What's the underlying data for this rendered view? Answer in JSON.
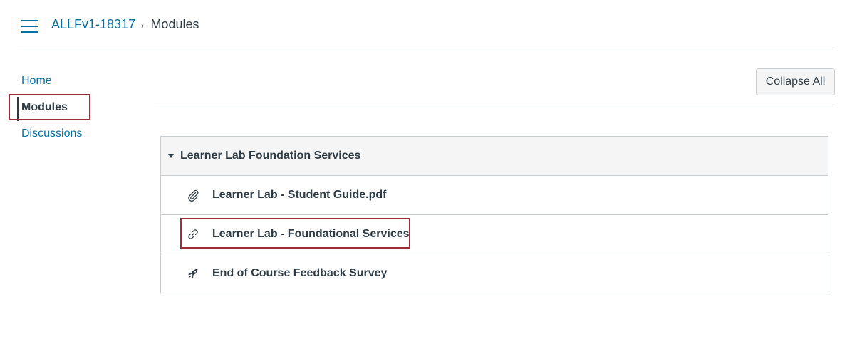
{
  "header": {
    "menu_icon": "hamburger-menu-icon",
    "breadcrumb": {
      "course": "ALLFv1-18317",
      "separator": "›",
      "current": "Modules"
    }
  },
  "course_nav": {
    "items": [
      {
        "label": "Home",
        "active": false
      },
      {
        "label": "Modules",
        "active": true
      },
      {
        "label": "Discussions",
        "active": false
      }
    ]
  },
  "toolbar": {
    "collapse_label": "Collapse All"
  },
  "module": {
    "expanded": true,
    "title": "Learner Lab Foundation Services",
    "items": [
      {
        "title": "Learner Lab - Student Guide.pdf",
        "icon": "paperclip-icon"
      },
      {
        "title": "Learner Lab - Foundational Services",
        "icon": "link-icon"
      },
      {
        "title": "End of Course Feedback Survey",
        "icon": "rocket-icon"
      }
    ]
  },
  "colors": {
    "link": "#0770a3",
    "text": "#2d3b45",
    "border": "#c7cdd1",
    "highlight": "#a12d3a",
    "header_bg": "#f5f5f5"
  }
}
